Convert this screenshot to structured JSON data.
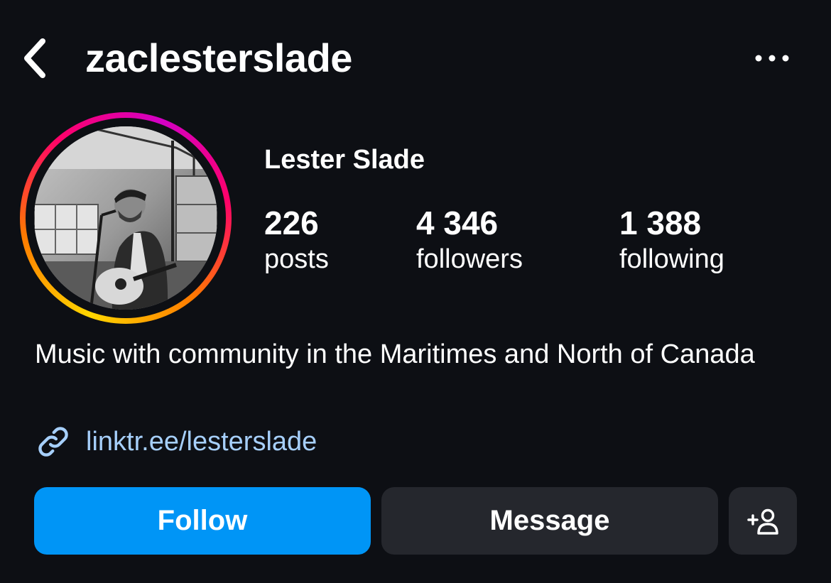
{
  "header": {
    "username": "zaclesterslade",
    "back_icon": "chevron-left-icon",
    "more_icon": "more-horizontal-icon"
  },
  "profile": {
    "display_name": "Lester Slade",
    "avatar_icon": "profile-photo",
    "story_ring_colors": [
      "#ffd600",
      "#ff7a00",
      "#ff0169",
      "#d300c5"
    ],
    "stats": [
      {
        "value": "226",
        "label": "posts"
      },
      {
        "value": "4 346",
        "label": "followers"
      },
      {
        "value": "1 388",
        "label": "following"
      }
    ],
    "bio": "Music with community in the Maritimes and North of Canada",
    "link": {
      "icon": "link-icon",
      "text": "linktr.ee/lesterslade"
    }
  },
  "actions": {
    "follow_label": "Follow",
    "message_label": "Message",
    "add_user_icon": "add-person-icon"
  },
  "colors": {
    "background": "#0d0f14",
    "follow_button": "#0095f6",
    "secondary_button": "#25272d",
    "link_text": "#a6cffb"
  }
}
